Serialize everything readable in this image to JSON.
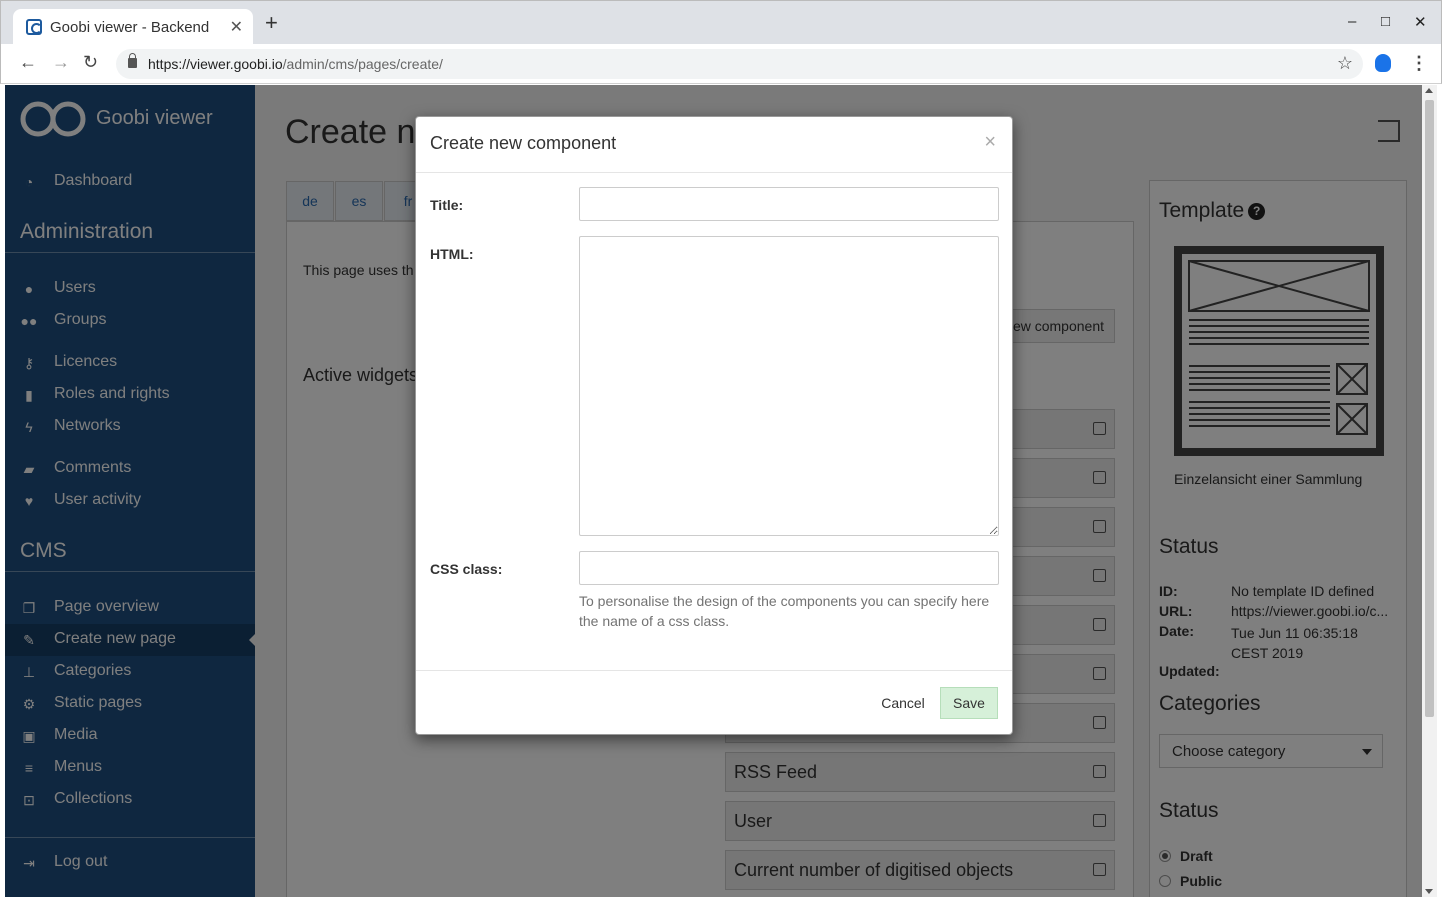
{
  "browser": {
    "tab_title": "Goobi viewer - Backend",
    "url_host": "https://viewer.goobi.io",
    "url_path": "/admin/cms/pages/create/"
  },
  "sidebar": {
    "logo_text": "Goobi viewer",
    "dashboard": "Dashboard",
    "section_admin": "Administration",
    "users": "Users",
    "groups": "Groups",
    "licences": "Licences",
    "roles": "Roles and rights",
    "networks": "Networks",
    "comments": "Comments",
    "user_activity": "User activity",
    "section_cms": "CMS",
    "page_overview": "Page overview",
    "create_page": "Create new page",
    "categories": "Categories",
    "static_pages": "Static pages",
    "media": "Media",
    "menus": "Menus",
    "collections": "Collections",
    "logout": "Log out"
  },
  "main": {
    "title": "Create ne",
    "lang_tabs": [
      "de",
      "es",
      "fr"
    ],
    "uses_text": "This page uses th",
    "new_component_btn": "ew component",
    "active_widgets": "Active widgets",
    "widgets": [
      "RSS Feed",
      "User",
      "Current number of digitised objects"
    ]
  },
  "right": {
    "template_heading": "Template",
    "template_name": "Einzelansicht einer Sammlung",
    "status_heading": "Status",
    "id_label": "ID:",
    "id_value": "No template ID defined",
    "url_label": "URL:",
    "url_value": "https://viewer.goobi.io/c...",
    "date_label": "Date:",
    "date_value": "Tue Jun 11 06:35:18 CEST 2019",
    "updated_label": "Updated:",
    "categories_heading": "Categories",
    "category_select": "Choose category",
    "status2_heading": "Status",
    "draft": "Draft",
    "public": "Public"
  },
  "modal": {
    "title": "Create new component",
    "title_label": "Title:",
    "title_value": "",
    "html_label": "HTML:",
    "html_value": "",
    "css_label": "CSS class:",
    "css_value": "",
    "css_help": "To personalise the design of the components you can specify here the name of a css class.",
    "cancel": "Cancel",
    "save": "Save"
  }
}
